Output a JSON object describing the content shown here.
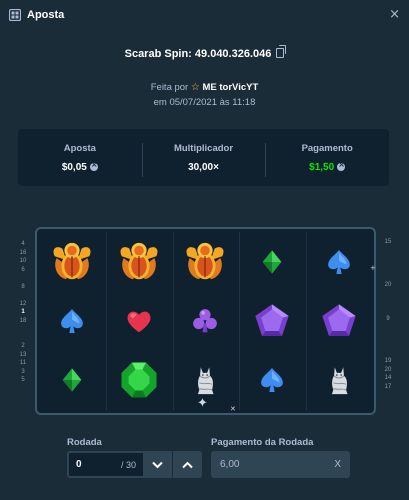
{
  "window": {
    "title": "Aposta",
    "close_glyph": "×"
  },
  "header": {
    "spin_label": "Scarab Spin: 49.040.326.046",
    "made_by_prefix": "Feita por",
    "username": "ME torVicYT",
    "date_line": "em 05/07/2021 às 11:18"
  },
  "stats": {
    "bet_label": "Aposta",
    "bet_value": "$0,05",
    "multiplier_label": "Multiplicador",
    "multiplier_value": "30,00×",
    "payout_label": "Pagamento",
    "payout_value": "$1,50",
    "payout_color": "#00e701"
  },
  "paylines": {
    "left": [
      "4",
      "16",
      "10",
      "6",
      "",
      "8",
      "",
      "12",
      "1",
      "18",
      "",
      "",
      "2",
      "13",
      "11",
      "3",
      "5"
    ],
    "right": [
      "15",
      "",
      "",
      "",
      "",
      "20",
      "",
      "",
      "",
      "9",
      "",
      "",
      "",
      "",
      "19",
      "20",
      "14",
      "17"
    ]
  },
  "reels": [
    [
      "scarab",
      "blue-spade",
      "green-diamond"
    ],
    [
      "scarab",
      "red-heart",
      "green-emerald"
    ],
    [
      "scarab",
      "purple-club",
      "white-cat"
    ],
    [
      "green-diamond",
      "purple-gem",
      "blue-spade"
    ],
    [
      "blue-spade",
      "purple-gem",
      "white-cat"
    ]
  ],
  "controls": {
    "round_label": "Rodada",
    "round_value": "0",
    "round_total": "/ 30",
    "round_payout_label": "Pagamento da Rodada",
    "round_payout_value": "6,00",
    "round_payout_suffix": "X"
  }
}
